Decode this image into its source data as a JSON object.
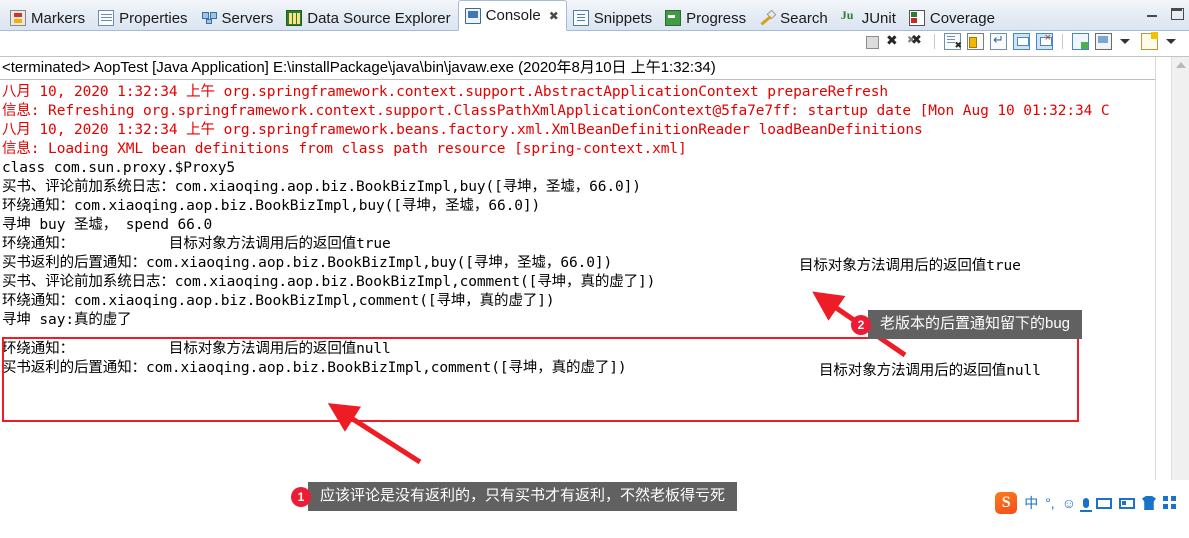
{
  "window": {
    "minimize_label": "minimize",
    "maximize_label": "maximize"
  },
  "tabbar": {
    "tabs": [
      {
        "label": "Markers",
        "icon": "markers-icon",
        "active": false
      },
      {
        "label": "Properties",
        "icon": "properties-icon",
        "active": false
      },
      {
        "label": "Servers",
        "icon": "servers-icon",
        "active": false
      },
      {
        "label": "Data Source Explorer",
        "icon": "database-icon",
        "active": false
      },
      {
        "label": "Console",
        "icon": "console-icon",
        "active": true
      },
      {
        "label": "Snippets",
        "icon": "snippets-icon",
        "active": false
      },
      {
        "label": "Progress",
        "icon": "progress-icon",
        "active": false
      },
      {
        "label": "Search",
        "icon": "search-icon",
        "active": false
      },
      {
        "label": "JUnit",
        "icon": "junit-icon",
        "active": false
      },
      {
        "label": "Coverage",
        "icon": "coverage-icon",
        "active": false
      }
    ],
    "active_tab_close": "✖"
  },
  "toolbar": {
    "buttons": [
      "terminate-icon",
      "remove-launch-icon",
      "remove-all-terminated-icon",
      "clear-console-icon",
      "scroll-lock-icon",
      "word-wrap-icon",
      "show-console-on-output-icon",
      "show-console-on-error-icon",
      "pin-console-icon",
      "display-selected-console-icon",
      "display-selected-console-menu-icon",
      "open-console-icon",
      "open-console-menu-icon"
    ]
  },
  "console": {
    "header": "<terminated> AopTest [Java Application] E:\\installPackage\\java\\bin\\javaw.exe (2020年8月10日 上午1:32:34)",
    "lines": [
      {
        "text": "八月 10, 2020 1:32:34 上午 org.springframework.context.support.AbstractApplicationContext prepareRefresh",
        "color": "red"
      },
      {
        "text": "信息: Refreshing org.springframework.context.support.ClassPathXmlApplicationContext@5fa7e7ff: startup date [Mon Aug 10 01:32:34 C",
        "color": "red"
      },
      {
        "text": "八月 10, 2020 1:32:34 上午 org.springframework.beans.factory.xml.XmlBeanDefinitionReader loadBeanDefinitions",
        "color": "red"
      },
      {
        "text": "信息: Loading XML bean definitions from class path resource [spring-context.xml]",
        "color": "red"
      },
      {
        "text": "class com.sun.proxy.$Proxy5",
        "color": "black"
      },
      {
        "text": "买书、评论前加系统日志：com.xiaoqing.aop.biz.BookBizImpl,buy([寻坤，圣墟，66.0])",
        "color": "black"
      },
      {
        "text": "环绕通知：com.xiaoqing.aop.biz.BookBizImpl,buy([寻坤，圣墟，66.0])",
        "color": "black"
      },
      {
        "text": "寻坤 buy 圣墟， spend 66.0",
        "color": "black"
      },
      {
        "text": "环绕通知：           目标对象方法调用后的返回值true",
        "color": "black"
      },
      {
        "text": "买书返利的后置通知：com.xiaoqing.aop.biz.BookBizImpl,buy([寻坤，圣墟，66.0])",
        "color": "black"
      },
      {
        "text": "买书、评论前加系统日志：com.xiaoqing.aop.biz.BookBizImpl,comment([寻坤，真的虚了])",
        "color": "black"
      },
      {
        "text": "环绕通知：com.xiaoqing.aop.biz.BookBizImpl,comment([寻坤，真的虚了])",
        "color": "black"
      },
      {
        "text": "寻坤 say:真的虚了",
        "color": "black"
      },
      {
        "text": "环绕通知：           目标对象方法调用后的返回值null",
        "color": "black"
      },
      {
        "text": "买书返利的后置通知：com.xiaoqing.aop.biz.BookBizImpl,comment([寻坤，真的虚了])",
        "color": "black"
      }
    ]
  },
  "annotations": {
    "right_note_true": "目标对象方法调用后的返回值true",
    "right_note_null": "目标对象方法调用后的返回值null",
    "callouts": [
      {
        "number": "1",
        "text": "应该评论是没有返利的，只有买书才有返利，不然老板得亏死"
      },
      {
        "number": "2",
        "text": "老版本的后置通知留下的bug"
      }
    ],
    "colors": {
      "highlight_box": "#ee1c25",
      "arrow": "#ee1c25",
      "badge": "#ec1c34",
      "bubble": "#616161",
      "console_red": "#e60000"
    }
  },
  "ime": {
    "logo": "S",
    "items": [
      {
        "label": "中",
        "icon": "language-mode-icon"
      },
      {
        "label": "°,",
        "icon": "punctuation-mode-icon"
      },
      {
        "label": "☺",
        "icon": "emoji-icon"
      },
      {
        "label": "",
        "icon": "microphone-icon"
      },
      {
        "label": "",
        "icon": "soft-keyboard-icon"
      },
      {
        "label": "",
        "icon": "handwriting-icon"
      },
      {
        "label": "",
        "icon": "skin-icon"
      },
      {
        "label": "",
        "icon": "toolbox-icon"
      }
    ]
  }
}
